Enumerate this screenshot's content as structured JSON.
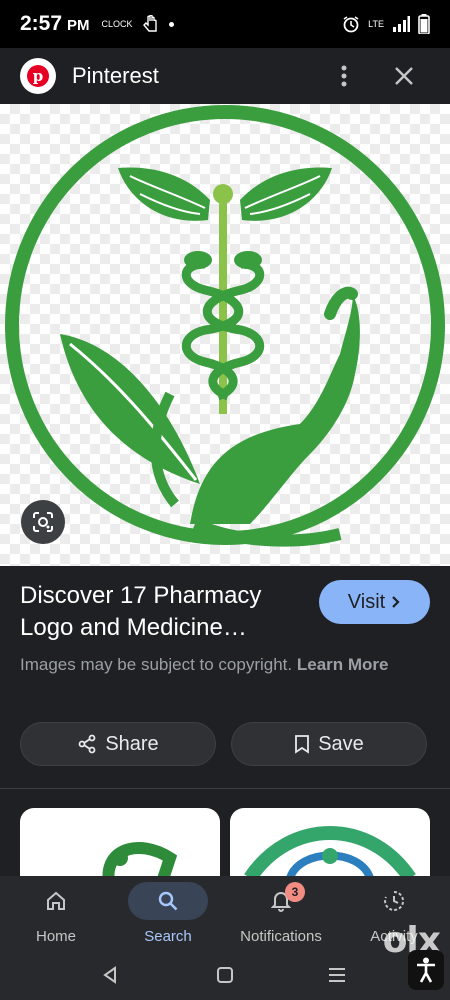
{
  "status_bar": {
    "time": "2:57",
    "ampm": "PM",
    "clock_icon_text": "CLOCK",
    "network_text": "LTE"
  },
  "header": {
    "site_name": "Pinterest",
    "logo_letter": "p"
  },
  "result": {
    "title": "Discover 17 Pharmacy Logo and Medicine…",
    "visit_label": "Visit",
    "copyright_text": "Images may be subject to copyright.",
    "learn_more": "Learn More",
    "share_label": "Share",
    "save_label": "Save"
  },
  "bottom_nav": {
    "items": [
      {
        "label": "Home",
        "icon": "home-icon"
      },
      {
        "label": "Search",
        "icon": "search-icon",
        "active": true
      },
      {
        "label": "Notifications",
        "icon": "bell-icon",
        "badge": "3"
      },
      {
        "label": "Activity",
        "icon": "activity-icon"
      }
    ]
  },
  "watermark": {
    "text": "olx"
  },
  "colors": {
    "accent": "#8ab4f8",
    "logo_green": "#3a9e3f",
    "pinterest_red": "#e60023",
    "badge": "#f28b82"
  }
}
